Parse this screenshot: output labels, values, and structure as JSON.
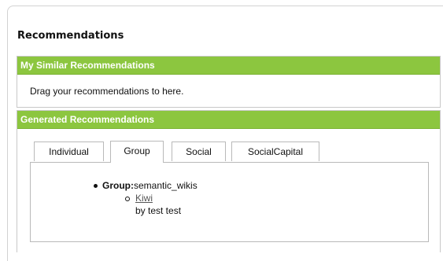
{
  "panel": {
    "title": "Recommendations"
  },
  "similar": {
    "header": "My Similar Recommendations",
    "drag_text": "Drag your recommendations to here."
  },
  "generated": {
    "header": "Generated Recommendations",
    "tabs": [
      {
        "label": "Individual",
        "active": false
      },
      {
        "label": "Group",
        "active": true
      },
      {
        "label": "Social",
        "active": false
      },
      {
        "label": "SocialCapital",
        "active": false
      }
    ],
    "group_item": {
      "label": "Group:",
      "value": "semantic_wikis",
      "link": "Kiwi",
      "by": "by test test"
    }
  },
  "colors": {
    "green_header": "#8cc63f"
  }
}
